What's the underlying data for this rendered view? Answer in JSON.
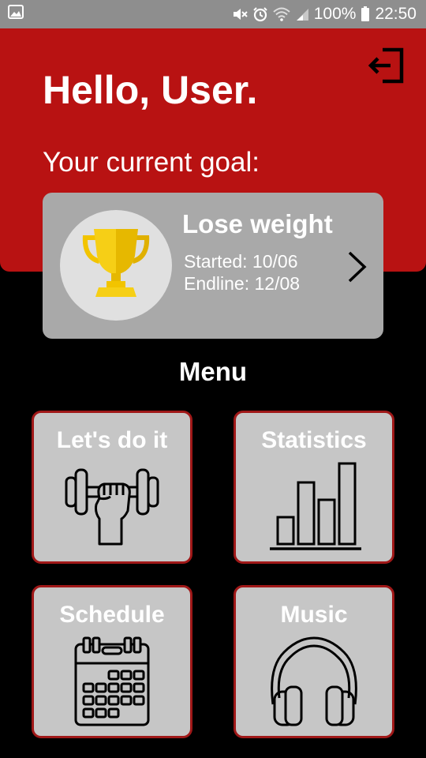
{
  "status_bar": {
    "battery_text": "100%",
    "time": "22:50",
    "icons": [
      "image-icon",
      "mute-icon",
      "alarm-icon",
      "wifi-icon",
      "signal-icon",
      "battery-icon"
    ]
  },
  "header": {
    "greeting": "Hello, User.",
    "goal_label": "Your current goal:",
    "logout_icon": "logout-icon",
    "background_color": "#b81212"
  },
  "goal": {
    "title": "Lose weight",
    "started": "Started: 10/06",
    "endline": "Endline: 12/08",
    "icon": "trophy-icon"
  },
  "menu": {
    "title": "Menu",
    "items": [
      {
        "label": "Let's do it",
        "icon": "dumbbell-icon"
      },
      {
        "label": "Statistics",
        "icon": "bar-chart-icon"
      },
      {
        "label": "Schedule",
        "icon": "calendar-icon"
      },
      {
        "label": "Music",
        "icon": "headphones-icon"
      }
    ]
  },
  "colors": {
    "accent_red": "#b81212",
    "tile_border": "#a01818",
    "tile_background": "#c6c6c6",
    "card_background": "#a9a9a9"
  }
}
